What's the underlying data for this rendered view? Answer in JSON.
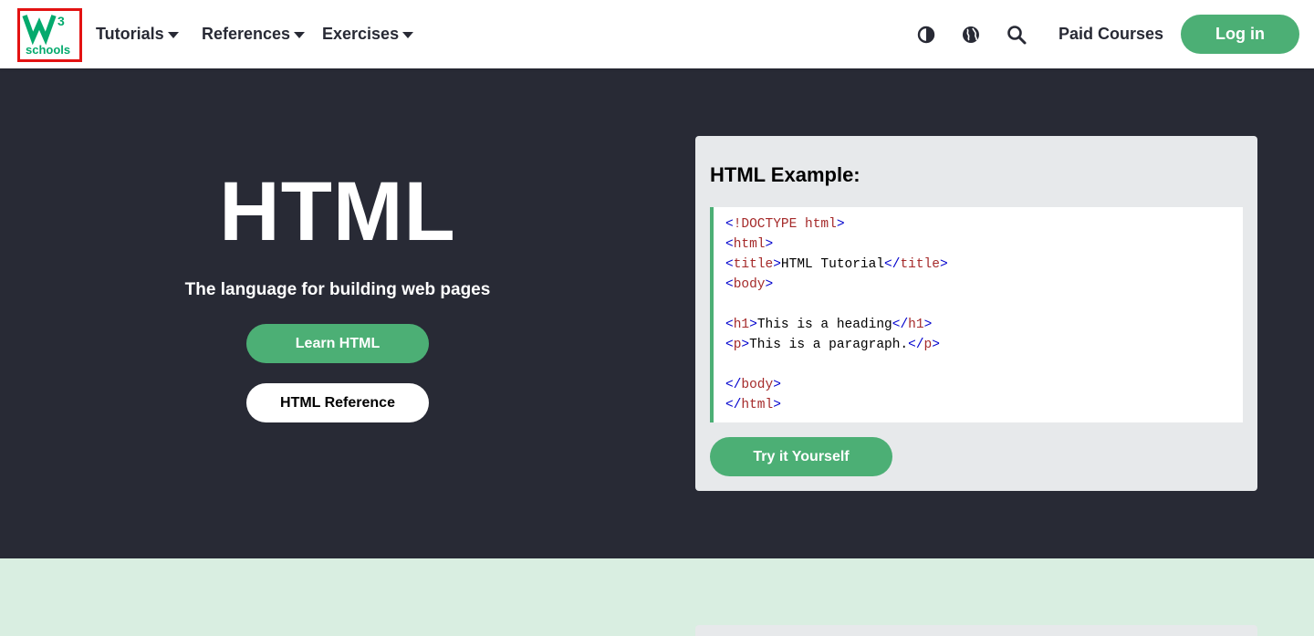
{
  "logo": {
    "text": "schools",
    "superscript": "3",
    "brand_color": "#04aa6d"
  },
  "nav": {
    "tutorials": "Tutorials",
    "references": "References",
    "exercises": "Exercises",
    "paid_courses": "Paid Courses",
    "login": "Log in"
  },
  "icons": {
    "theme": "contrast-icon",
    "language": "globe-icon",
    "search": "search-icon",
    "caret": "caret-down-icon"
  },
  "hero": {
    "title": "HTML",
    "subtitle": "The language for building web pages",
    "learn_button": "Learn HTML",
    "reference_button": "HTML Reference"
  },
  "example": {
    "title": "HTML Example:",
    "try_button": "Try it Yourself",
    "code_lines": [
      "<!DOCTYPE html>",
      "<html>",
      "<title>HTML Tutorial</title>",
      "<body>",
      "",
      "<h1>This is a heading</h1>",
      "<p>This is a paragraph.</p>",
      "",
      "</body>",
      "</html>"
    ]
  },
  "colors": {
    "dark_bg": "#282a35",
    "accent_green": "#4caf75",
    "light_green_bg": "#d9eee1",
    "example_bg": "#e7e9eb",
    "tag_bracket": "#0000cd",
    "tag_name": "#a52a2a"
  }
}
